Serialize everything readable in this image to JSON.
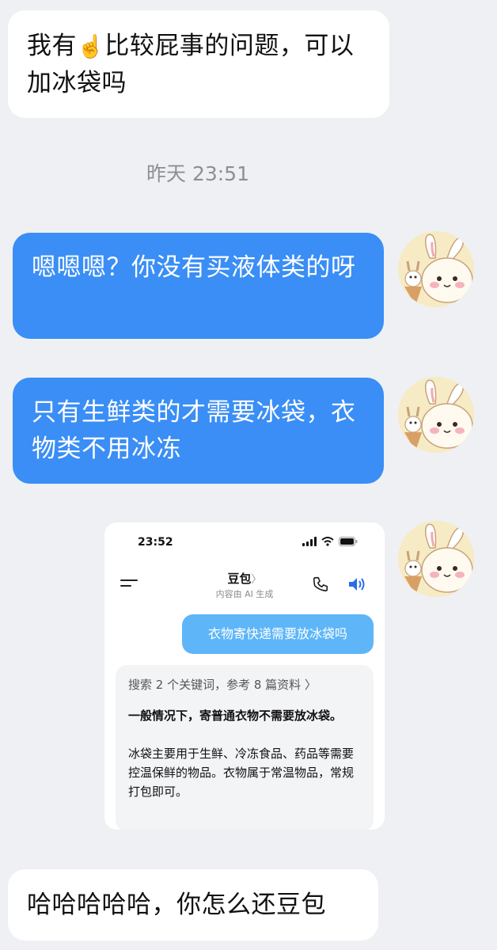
{
  "messages": [
    {
      "side": "left",
      "text_before": "我有",
      "emoji": "☝️",
      "text_after": "比较屁事的问题，可以加冰袋吗"
    },
    {
      "side": "right",
      "text": "嗯嗯嗯？你没有买液体类的呀"
    },
    {
      "side": "right",
      "text": "只有生鲜类的才需要冰袋，衣物类不用冰冻"
    },
    {
      "side": "left",
      "text": "哈哈哈哈哈，你怎么还豆包"
    }
  ],
  "timestamp": "昨天 23:51",
  "embedded_screenshot": {
    "status_time": "23:52",
    "title": "豆包",
    "title_chevron": "〉",
    "subtitle": "内容由 AI 生成",
    "user_question": "衣物寄快递需要放冰袋吗",
    "search_summary": "搜索 2 个关键词，参考 8 篇资料 〉",
    "answer_bold": "一般情况下，寄普通衣物不需要放冰袋。",
    "answer_body": "冰袋主要用于生鲜、冷冻食品、药品等需要控温保鲜的物品。衣物属于常温物品，常规打包即可。"
  },
  "icons": [
    "pointing-up-emoji",
    "menu-icon",
    "phone-icon",
    "speaker-icon",
    "signal-icon",
    "wifi-icon",
    "battery-icon",
    "avatar-bunny"
  ],
  "colors": {
    "background": "#eef0f3",
    "bubble_left": "#ffffff",
    "bubble_right": "#3a8ef5",
    "user_question": "#5eb6f8",
    "answer_bg": "#f3f4f6"
  }
}
